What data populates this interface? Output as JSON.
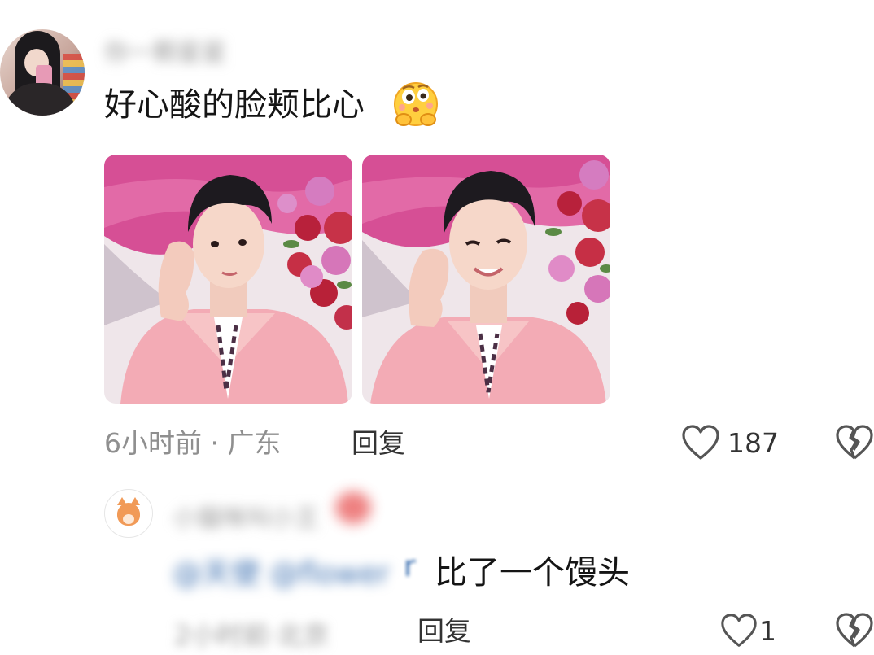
{
  "comment": {
    "author_name": "你一颗星星",
    "text": "好心酸的脸颊比心",
    "emoji": "thinking-kiss-emoji",
    "images": [
      {
        "name": "photo-1",
        "subject": "pink-shirt-portrait"
      },
      {
        "name": "photo-2",
        "subject": "pink-shirt-portrait"
      }
    ],
    "time": "6小时前 · 广东",
    "reply_label": "回复",
    "likes": "187",
    "like_icon": "heart-outline-icon",
    "dislike_icon": "broken-heart-icon"
  },
  "reply": {
    "author_name": "小猫咪叫小王",
    "mentions": "@天使 @flower",
    "mention_tail": "r",
    "text": "比了一个馒头",
    "time": "2小时前·北京",
    "reply_label": "回复",
    "likes": "1"
  },
  "colors": {
    "text_primary": "#151515",
    "text_secondary": "#8f8f8f",
    "mention": "#3b6fb0",
    "photo_background": "#d8589b",
    "shirt": "#f2a9b1"
  }
}
